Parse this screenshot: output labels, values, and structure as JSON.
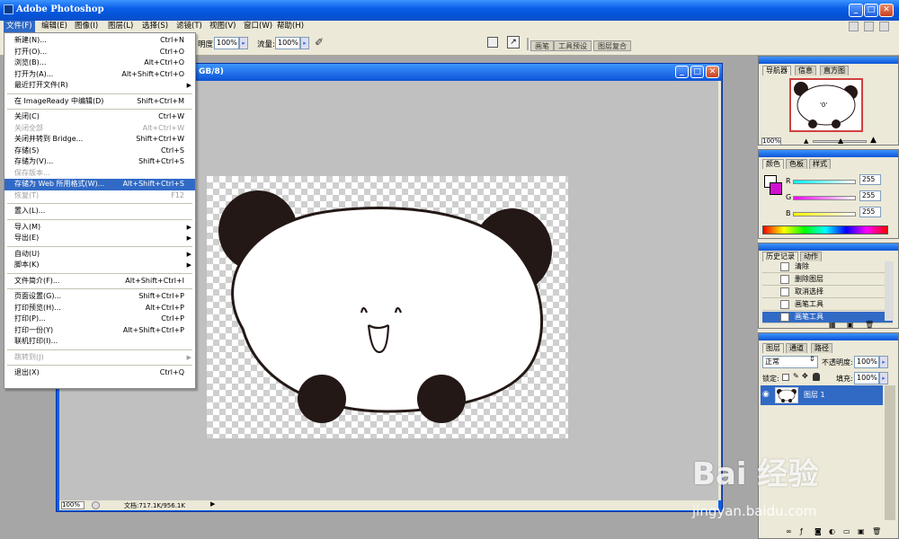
{
  "app": {
    "title": "Adobe Photoshop"
  },
  "menubar": [
    {
      "label": "文件(F)"
    },
    {
      "label": "编辑(E)"
    },
    {
      "label": "图像(I)"
    },
    {
      "label": "图层(L)"
    },
    {
      "label": "选择(S)"
    },
    {
      "label": "滤镜(T)"
    },
    {
      "label": "视图(V)"
    },
    {
      "label": "窗口(W)"
    },
    {
      "label": "帮助(H)"
    }
  ],
  "options": {
    "opacity_label": "明度:",
    "opacity_value": "100%",
    "flow_label": "流量:",
    "flow_value": "100%",
    "well_tabs": [
      "画笔",
      "工具预设",
      "图层复合"
    ]
  },
  "file_menu": [
    {
      "label": "新建(N)...",
      "shortcut": "Ctrl+N"
    },
    {
      "label": "打开(O)...",
      "shortcut": "Ctrl+O"
    },
    {
      "label": "浏览(B)...",
      "shortcut": "Alt+Ctrl+O"
    },
    {
      "label": "打开为(A)...",
      "shortcut": "Alt+Shift+Ctrl+O"
    },
    {
      "label": "最近打开文件(R)",
      "shortcut": "",
      "submenu": true
    },
    {
      "sep": true
    },
    {
      "label": "在 ImageReady 中编辑(D)",
      "shortcut": "Shift+Ctrl+M"
    },
    {
      "sep": true
    },
    {
      "label": "关闭(C)",
      "shortcut": "Ctrl+W"
    },
    {
      "label": "关闭全部",
      "shortcut": "Alt+Ctrl+W",
      "disabled": true
    },
    {
      "label": "关闭并转到 Bridge...",
      "shortcut": "Shift+Ctrl+W"
    },
    {
      "label": "存储(S)",
      "shortcut": "Ctrl+S"
    },
    {
      "label": "存储为(V)...",
      "shortcut": "Shift+Ctrl+S"
    },
    {
      "label": "保存版本...",
      "shortcut": "",
      "disabled": true
    },
    {
      "label": "存储为 Web 所用格式(W)...",
      "shortcut": "Alt+Shift+Ctrl+S",
      "highlighted": true
    },
    {
      "label": "恢复(T)",
      "shortcut": "F12",
      "disabled": true
    },
    {
      "sep": true
    },
    {
      "label": "置入(L)...",
      "shortcut": ""
    },
    {
      "sep": true
    },
    {
      "label": "导入(M)",
      "shortcut": "",
      "submenu": true
    },
    {
      "label": "导出(E)",
      "shortcut": "",
      "submenu": true
    },
    {
      "sep": true
    },
    {
      "label": "自动(U)",
      "shortcut": "",
      "submenu": true
    },
    {
      "label": "脚本(K)",
      "shortcut": "",
      "submenu": true
    },
    {
      "sep": true
    },
    {
      "label": "文件简介(F)...",
      "shortcut": "Alt+Shift+Ctrl+I"
    },
    {
      "sep": true
    },
    {
      "label": "页面设置(G)...",
      "shortcut": "Shift+Ctrl+P"
    },
    {
      "label": "打印预览(H)...",
      "shortcut": "Alt+Ctrl+P"
    },
    {
      "label": "打印(P)...",
      "shortcut": "Ctrl+P"
    },
    {
      "label": "打印一份(Y)",
      "shortcut": "Alt+Shift+Ctrl+P"
    },
    {
      "label": "联机打印(I)...",
      "shortcut": ""
    },
    {
      "sep": true
    },
    {
      "label": "跳转到(J)",
      "shortcut": "",
      "submenu": true,
      "disabled": true
    },
    {
      "sep": true
    },
    {
      "label": "退出(X)",
      "shortcut": "Ctrl+Q"
    }
  ],
  "document": {
    "title_fragment": "GB/8)",
    "zoom": "100%",
    "doc_size": "文档:717.1K/956.1K"
  },
  "navigator": {
    "tabs": [
      "导航器",
      "信息",
      "直方图"
    ],
    "zoom": "100%",
    "face_text": "'0'"
  },
  "color": {
    "tabs": [
      "颜色",
      "色板",
      "样式"
    ],
    "channels": [
      {
        "name": "R",
        "value": "255"
      },
      {
        "name": "G",
        "value": "255"
      },
      {
        "name": "B",
        "value": "255"
      }
    ]
  },
  "history": {
    "tabs": [
      "历史记录",
      "动作"
    ],
    "items": [
      {
        "label": "清除"
      },
      {
        "label": "删除图层"
      },
      {
        "label": "取消选择"
      },
      {
        "label": "画笔工具"
      },
      {
        "label": "画笔工具",
        "selected": true
      }
    ]
  },
  "layers": {
    "tabs": [
      "图层",
      "通道",
      "路径"
    ],
    "blend_mode": "正常",
    "opacity_label": "不透明度:",
    "opacity_value": "100%",
    "lock_label": "锁定:",
    "fill_label": "填充:",
    "fill_value": "100%",
    "items": [
      {
        "name": "图层 1"
      }
    ]
  },
  "watermark": {
    "brand": "Bai 经验",
    "url": "jingyan.baidu.com"
  },
  "colors": {
    "xp_blue": "#0a5fe8",
    "menu_highlight": "#316ac5",
    "workspace_gray": "#a6a6a6",
    "panda_black": "#231815"
  }
}
